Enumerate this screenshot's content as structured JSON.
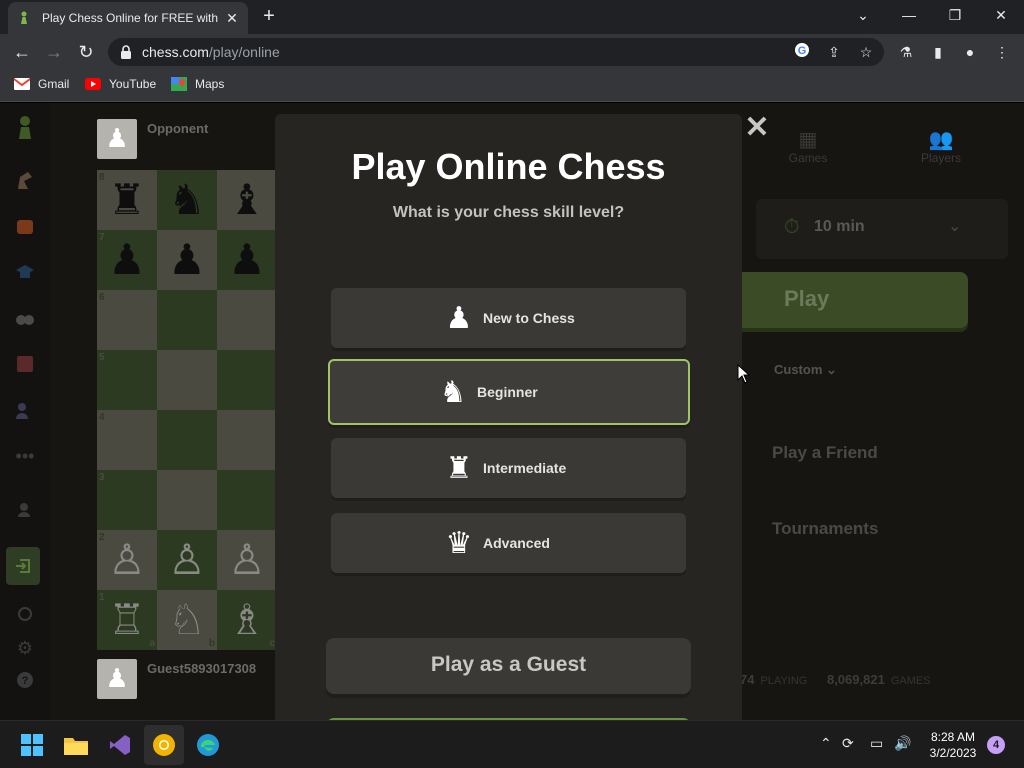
{
  "browser": {
    "tab_title": "Play Chess Online for FREE with F",
    "url_domain": "chess.com",
    "url_path": "/play/online",
    "bookmarks": [
      {
        "label": "Gmail",
        "icon": "gmail-icon"
      },
      {
        "label": "YouTube",
        "icon": "youtube-icon"
      },
      {
        "label": "Maps",
        "icon": "maps-icon"
      }
    ]
  },
  "board": {
    "opponent_name": "Opponent",
    "player_name": "Guest5893017308",
    "ranks": [
      "8",
      "7",
      "6",
      "5",
      "4",
      "3",
      "2",
      "1"
    ],
    "files_visible": [
      "a",
      "b",
      "c"
    ],
    "pieces": {
      "rank8": [
        "♜",
        "♞",
        "♝"
      ],
      "rank7": [
        "♟",
        "♟",
        "♟"
      ],
      "rank2": [
        "♙",
        "♙",
        "♙"
      ],
      "rank1": [
        "♖",
        "♘",
        "♗"
      ]
    }
  },
  "right_panel": {
    "tabs": [
      "Games",
      "Players"
    ],
    "time_control": "10 min",
    "play_label": "Play",
    "custom_label": "Custom",
    "play_friend_label": "Play a Friend",
    "tournaments_label": "Tournaments",
    "playing_count": "74",
    "playing_label": "PLAYING",
    "games_count": "8,069,821",
    "games_label": "GAMES"
  },
  "modal": {
    "title": "Play Online Chess",
    "subtitle": "What is your chess skill level?",
    "options": [
      {
        "label": "New to Chess",
        "icon": "♟"
      },
      {
        "label": "Beginner",
        "icon": "♞",
        "selected": true
      },
      {
        "label": "Intermediate",
        "icon": "♜"
      },
      {
        "label": "Advanced",
        "icon": "♛"
      }
    ],
    "guest_button": "Play as a Guest"
  },
  "taskbar": {
    "time": "8:28 AM",
    "date": "3/2/2023",
    "notifications": "4"
  },
  "colors": {
    "accent_green": "#81b64c",
    "selected_border": "#a1c466",
    "modal_bg": "#272522"
  }
}
